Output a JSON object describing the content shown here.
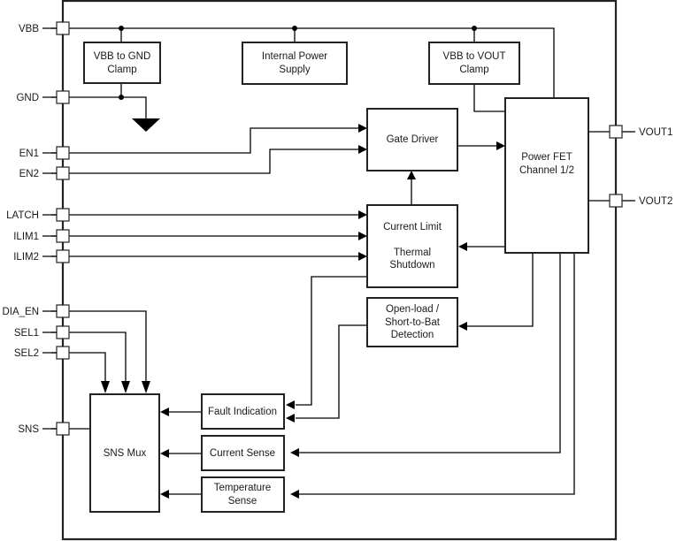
{
  "diagram": {
    "type": "functional-block-diagram",
    "pins_left": [
      {
        "id": "vbb",
        "label": "VBB"
      },
      {
        "id": "gnd",
        "label": "GND"
      },
      {
        "id": "en1",
        "label": "EN1"
      },
      {
        "id": "en2",
        "label": "EN2"
      },
      {
        "id": "latch",
        "label": "LATCH"
      },
      {
        "id": "ilim1",
        "label": "ILIM1"
      },
      {
        "id": "ilim2",
        "label": "ILIM2"
      },
      {
        "id": "dia_en",
        "label": "DIA_EN"
      },
      {
        "id": "sel1",
        "label": "SEL1"
      },
      {
        "id": "sel2",
        "label": "SEL2"
      },
      {
        "id": "sns",
        "label": "SNS"
      }
    ],
    "pins_right": [
      {
        "id": "vout1",
        "label": "VOUT1"
      },
      {
        "id": "vout2",
        "label": "VOUT2"
      }
    ],
    "blocks": {
      "vbb_gnd_clamp": [
        "VBB to GND",
        "Clamp"
      ],
      "internal_power": [
        "Internal Power",
        "Supply"
      ],
      "vbb_vout_clamp": [
        "VBB to VOUT",
        "Clamp"
      ],
      "gate_driver": [
        "Gate Driver"
      ],
      "power_fet": [
        "Power FET",
        "Channel 1/2"
      ],
      "current_limit": [
        "Current Limit",
        "",
        "Thermal",
        "Shutdown"
      ],
      "open_load": [
        "Open-load /",
        "Short-to-Bat",
        "Detection"
      ],
      "fault_indication": [
        "Fault Indication"
      ],
      "current_sense": [
        "Current Sense"
      ],
      "temperature_sense": [
        "Temperature",
        "Sense"
      ],
      "sns_mux": [
        "SNS Mux"
      ]
    },
    "connections": [
      {
        "from": "VBB",
        "to": "VBB to GND Clamp"
      },
      {
        "from": "VBB",
        "to": "Internal Power Supply"
      },
      {
        "from": "VBB",
        "to": "VBB to VOUT Clamp"
      },
      {
        "from": "VBB",
        "to": "Power FET Channel 1/2"
      },
      {
        "from": "VBB to GND Clamp",
        "to": "GND"
      },
      {
        "from": "VBB to VOUT Clamp",
        "to": "Power FET Channel 1/2"
      },
      {
        "from": "EN1",
        "to": "Gate Driver"
      },
      {
        "from": "EN2",
        "to": "Gate Driver"
      },
      {
        "from": "Gate Driver",
        "to": "Power FET Channel 1/2"
      },
      {
        "from": "Current Limit / Thermal Shutdown",
        "to": "Gate Driver"
      },
      {
        "from": "LATCH",
        "to": "Current Limit / Thermal Shutdown"
      },
      {
        "from": "ILIM1",
        "to": "Current Limit / Thermal Shutdown"
      },
      {
        "from": "ILIM2",
        "to": "Current Limit / Thermal Shutdown"
      },
      {
        "from": "Power FET Channel 1/2",
        "to": "Current Limit / Thermal Shutdown"
      },
      {
        "from": "Power FET Channel 1/2",
        "to": "Open-load / Short-to-Bat Detection"
      },
      {
        "from": "Power FET Channel 1/2",
        "to": "Current Sense"
      },
      {
        "from": "Power FET Channel 1/2",
        "to": "Temperature Sense"
      },
      {
        "from": "Power FET Channel 1/2",
        "to": "VOUT1"
      },
      {
        "from": "Power FET Channel 1/2",
        "to": "VOUT2"
      },
      {
        "from": "Current Limit / Thermal Shutdown",
        "to": "Fault Indication"
      },
      {
        "from": "Open-load / Short-to-Bat Detection",
        "to": "Fault Indication"
      },
      {
        "from": "Fault Indication",
        "to": "SNS Mux"
      },
      {
        "from": "Current Sense",
        "to": "SNS Mux"
      },
      {
        "from": "Temperature Sense",
        "to": "SNS Mux"
      },
      {
        "from": "DIA_EN",
        "to": "SNS Mux"
      },
      {
        "from": "SEL1",
        "to": "SNS Mux"
      },
      {
        "from": "SEL2",
        "to": "SNS Mux"
      },
      {
        "from": "SNS Mux",
        "to": "SNS"
      }
    ]
  }
}
